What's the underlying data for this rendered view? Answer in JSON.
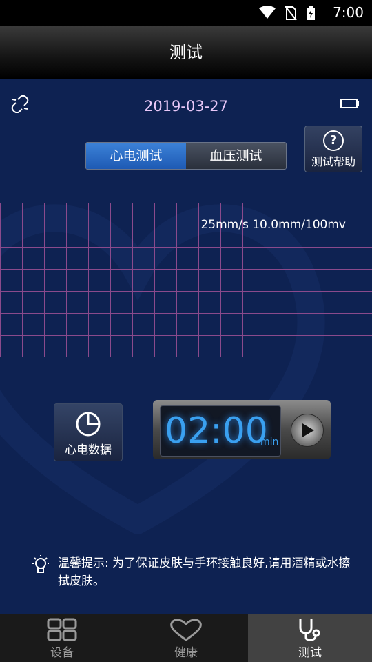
{
  "status_bar": {
    "time": "7:00"
  },
  "header": {
    "title": "测试"
  },
  "main": {
    "date": "2019-03-27",
    "segments": [
      {
        "label": "心电测试",
        "active": true
      },
      {
        "label": "血压测试",
        "active": false
      }
    ],
    "help_label": "测试帮助",
    "scale": "25mm/s 10.0mm/100mv",
    "ecg_data_label": "心电数据",
    "timer": {
      "value": "02:00",
      "unit": "min"
    },
    "tip": "温馨提示: 为了保证皮肤与手环接触良好,请用酒精或水擦拭皮肤。"
  },
  "tabs": [
    {
      "label": "设备",
      "icon": "grid-icon",
      "active": false
    },
    {
      "label": "健康",
      "icon": "heart-icon",
      "active": false
    },
    {
      "label": "测试",
      "icon": "stethoscope-icon",
      "active": true
    }
  ],
  "colors": {
    "accent": "#2e72cc",
    "grid": "#8a4a8c",
    "digits": "#3aa0f0",
    "date": "#e8c8f8"
  }
}
